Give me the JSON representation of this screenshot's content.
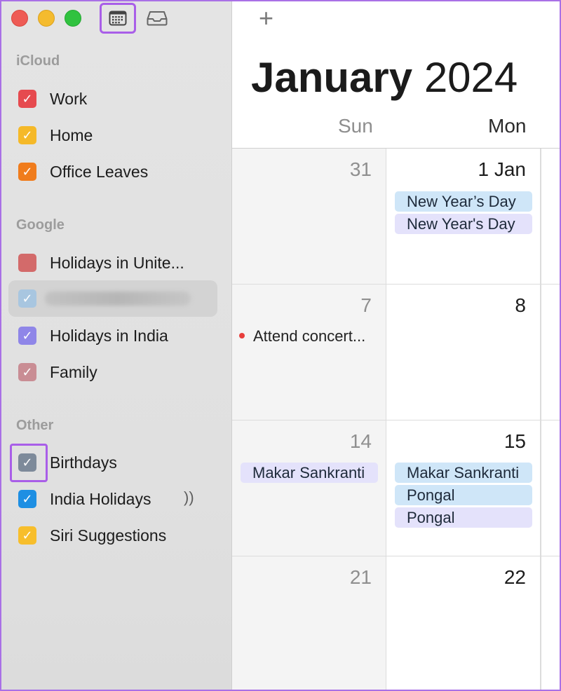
{
  "sidebar": {
    "sections": {
      "icloud": "iCloud",
      "google": "Google",
      "other": "Other"
    },
    "calendars": [
      {
        "label": "Work",
        "color": "#e64a4f",
        "checked": true
      },
      {
        "label": "Home",
        "color": "#f5b929",
        "checked": true
      },
      {
        "label": "Office Leaves",
        "color": "#f07c1c",
        "checked": true
      },
      {
        "label": "Holidays in Unite...",
        "color": "#d36a6a",
        "checked": false
      },
      {
        "label": "",
        "color": "#a8c6e0",
        "checked": true,
        "blurred": true
      },
      {
        "label": "Holidays in India",
        "color": "#8f86e8",
        "checked": true
      },
      {
        "label": "Family",
        "color": "#c98d94",
        "checked": true
      },
      {
        "label": "Birthdays",
        "color": "#7d8a9a",
        "checked": true
      },
      {
        "label": "India Holidays",
        "color": "#1e8fe3",
        "checked": true
      },
      {
        "label": "Siri Suggestions",
        "color": "#f7be2c",
        "checked": true
      }
    ],
    "check_glyph": "✓",
    "wave_glyph": "))"
  },
  "toolbar": {
    "add_glyph": "+"
  },
  "header": {
    "month": "January",
    "year": "2024"
  },
  "weekdays": [
    "Sun",
    "Mon"
  ],
  "weeks": [
    {
      "sun": {
        "day": "31",
        "events": []
      },
      "mon": {
        "day": "1 Jan",
        "events": [
          {
            "label": "New Year’s Day",
            "style": "blue"
          },
          {
            "label": "New Year's Day",
            "style": "lavender"
          }
        ]
      }
    },
    {
      "sun": {
        "day": "7",
        "dot_event": "Attend concert..."
      },
      "mon": {
        "day": "8",
        "events": []
      }
    },
    {
      "sun": {
        "day": "14",
        "events": [
          {
            "label": "Makar Sankranti",
            "style": "lavender"
          }
        ]
      },
      "mon": {
        "day": "15",
        "events": [
          {
            "label": "Makar Sankranti",
            "style": "blue"
          },
          {
            "label": "Pongal",
            "style": "blue"
          },
          {
            "label": "Pongal",
            "style": "lavender"
          }
        ]
      }
    },
    {
      "sun": {
        "day": "21",
        "events": []
      },
      "mon": {
        "day": "22",
        "events": []
      }
    }
  ]
}
